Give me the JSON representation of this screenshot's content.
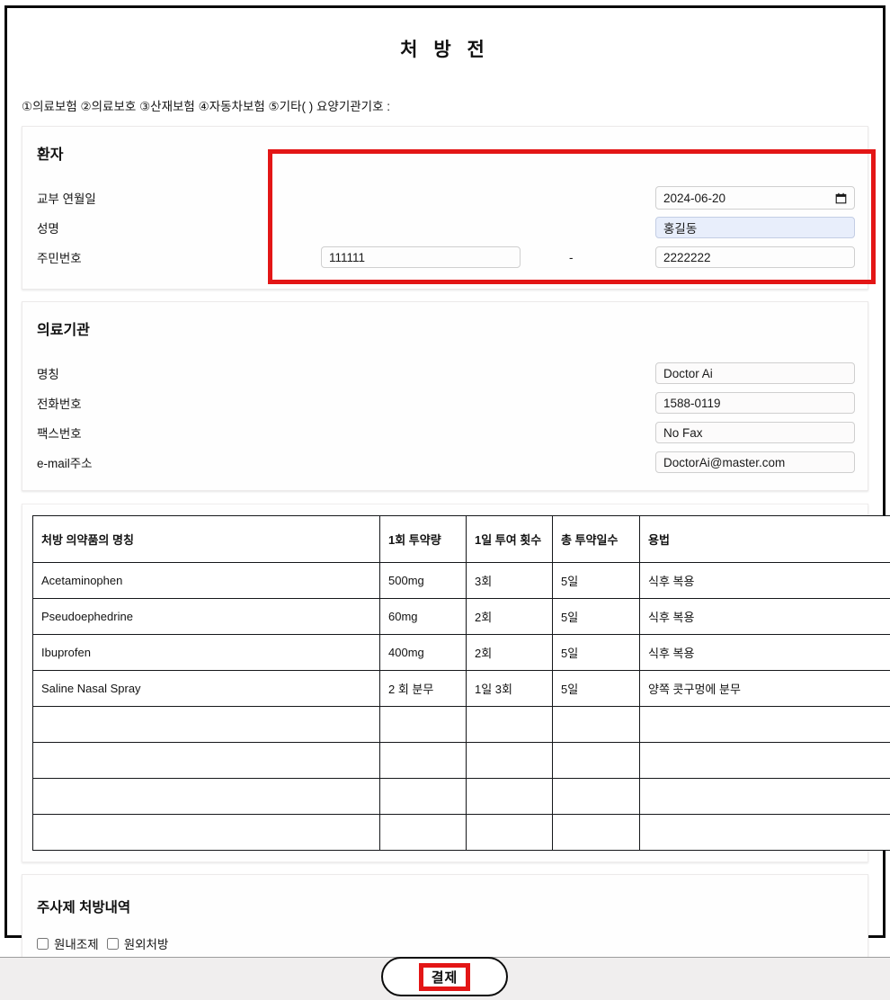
{
  "document": {
    "title": "처 방 전",
    "insurance_line": "①의료보험 ②의료보호 ③산재보험 ④자동차보험 ⑤기타( ) 요양기관기호 :"
  },
  "patient": {
    "heading": "환자",
    "issue_date_label": "교부 연월일",
    "issue_date_value": "2024-06-20",
    "calendar_icon": "calendar-icon",
    "name_label": "성명",
    "name_value": "홍길동",
    "rrn_label": "주민번호",
    "rrn_first": "111111",
    "rrn_separator": "-",
    "rrn_second": "2222222"
  },
  "institution": {
    "heading": "의료기관",
    "name_label": "명칭",
    "name_value": "Doctor Ai",
    "phone_label": "전화번호",
    "phone_value": "1588-0119",
    "fax_label": "팩스번호",
    "fax_value": "No Fax",
    "email_label": "e-mail주소",
    "email_value": "DoctorAi@master.com"
  },
  "prescription_table": {
    "columns": [
      "처방 의약품의 명칭",
      "1회 투약량",
      "1일 투여 횟수",
      "총 투약일수",
      "용법"
    ],
    "rows": [
      {
        "name": "Acetaminophen",
        "dose": "500mg",
        "frequency": "3회",
        "days": "5일",
        "usage": "식후 복용"
      },
      {
        "name": "Pseudoephedrine",
        "dose": "60mg",
        "frequency": "2회",
        "days": "5일",
        "usage": "식후 복용"
      },
      {
        "name": "Ibuprofen",
        "dose": "400mg",
        "frequency": "2회",
        "days": "5일",
        "usage": "식후 복용"
      },
      {
        "name": "Saline Nasal Spray",
        "dose": "2 회 분무",
        "frequency": "1일 3회",
        "days": "5일",
        "usage": "양쪽 콧구멍에 분무"
      },
      {
        "name": "",
        "dose": "",
        "frequency": "",
        "days": "",
        "usage": ""
      },
      {
        "name": "",
        "dose": "",
        "frequency": "",
        "days": "",
        "usage": ""
      },
      {
        "name": "",
        "dose": "",
        "frequency": "",
        "days": "",
        "usage": ""
      },
      {
        "name": "",
        "dose": "",
        "frequency": "",
        "days": "",
        "usage": ""
      }
    ]
  },
  "injection": {
    "heading": "주사제 처방내역",
    "options": [
      {
        "label": "원내조제",
        "checked": false
      },
      {
        "label": "원외처방",
        "checked": false
      }
    ]
  },
  "footer": {
    "pay_button_label": "결제"
  },
  "annotations": {
    "highlight_color": "#e31616"
  }
}
